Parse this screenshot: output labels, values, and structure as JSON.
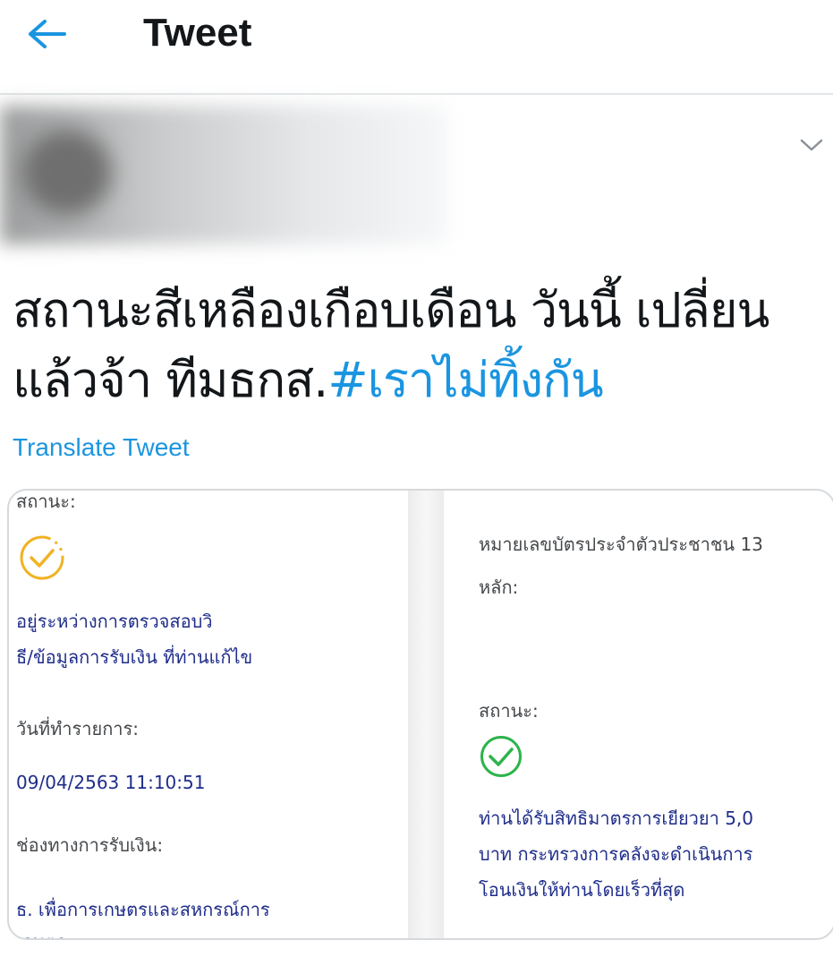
{
  "header": {
    "title": "Tweet"
  },
  "tweet": {
    "text_plain": "สถานะสีเหลืองเกือบเดือน วันนี้ เปลี่ยนแล้วจ้า ทีมธกส.",
    "hashtag": "#เราไม่ทิ้งกัน",
    "translate_label": "Translate Tweet"
  },
  "media": {
    "left": {
      "status_label": "สถานะ:",
      "status_text_line1": "อยู่ระหว่างการตรวจสอบวิ",
      "status_text_line2": "ธี/ข้อมูลการรับเงิน ที่ท่านแก้ไข",
      "date_label": "วันที่ทำรายการ:",
      "date_value": "09/04/2563 11:10:51",
      "channel_label": "ช่องทางการรับเงิน:",
      "channel_value_line1": "ธ. เพื่อการเกษตรและสหกรณ์การ",
      "channel_value_line2": "เกษตร"
    },
    "right": {
      "id_label_line1": "หมายเลขบัตรประจำตัวประชาชน 13",
      "id_label_line2": "หลัก:",
      "status_label": "สถานะ:",
      "status_text_line1": "ท่านได้รับสิทธิมาตรการเยียวยา 5,0",
      "status_text_line2": "บาท กระทรวงการคลังจะดำเนินการ",
      "status_text_line3": "โอนเงินให้ท่านโดยเร็วที่สุด"
    }
  },
  "colors": {
    "accent": "#1b95e0",
    "pending": "#f0b323",
    "success": "#2db34a",
    "value_text": "#1f2d8a"
  },
  "icons": [
    "back-arrow-icon",
    "chevron-down-icon",
    "pending-check-icon",
    "success-check-icon"
  ]
}
